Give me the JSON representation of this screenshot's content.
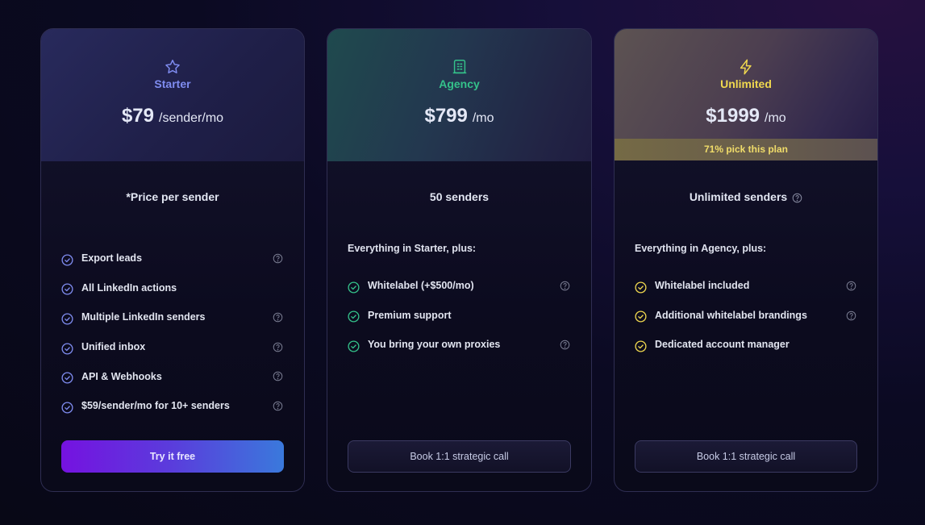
{
  "plans": [
    {
      "name": "Starter",
      "icon": "star-icon",
      "accent": "#7f8cf0",
      "price": "$79",
      "period": "/sender/mo",
      "subtitle": "*Price per sender",
      "features": [
        {
          "label": "Export leads",
          "help": true
        },
        {
          "label": "All LinkedIn actions",
          "help": false
        },
        {
          "label": "Multiple LinkedIn senders",
          "help": true
        },
        {
          "label": "Unified inbox",
          "help": true
        },
        {
          "label": "API & Webhooks",
          "help": true
        },
        {
          "label": "$59/sender/mo for 10+ senders",
          "help": true
        }
      ],
      "cta": "Try it free"
    },
    {
      "name": "Agency",
      "icon": "building-icon",
      "accent": "#34c28a",
      "price": "$799",
      "period": "/mo",
      "subtitle": "50 senders",
      "plus_heading": "Everything in Starter, plus:",
      "features": [
        {
          "label": "Whitelabel (+$500/mo)",
          "help": true
        },
        {
          "label": "Premium support",
          "help": false
        },
        {
          "label": "You bring your own proxies",
          "help": true
        }
      ],
      "cta": "Book 1:1 strategic call"
    },
    {
      "name": "Unlimited",
      "icon": "lightning-icon",
      "accent": "#f0d84f",
      "price": "$1999",
      "period": "/mo",
      "badge": "71% pick this plan",
      "subtitle": "Unlimited senders",
      "plus_heading": "Everything in Agency, plus:",
      "features": [
        {
          "label": "Whitelabel included",
          "help": true
        },
        {
          "label": "Additional whitelabel brandings",
          "help": true
        },
        {
          "label": "Dedicated account manager",
          "help": false
        }
      ],
      "cta": "Book 1:1 strategic call"
    }
  ]
}
